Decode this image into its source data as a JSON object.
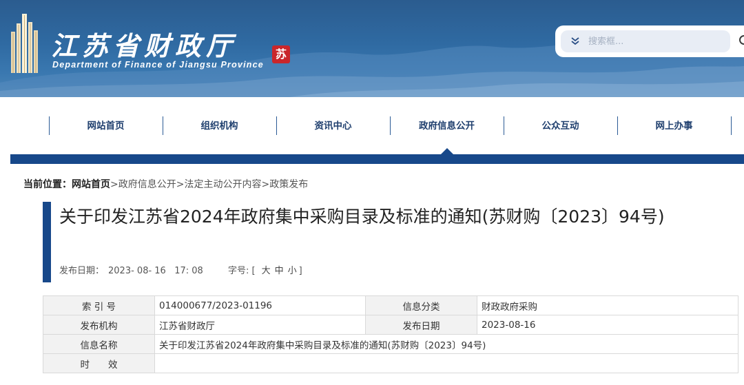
{
  "header": {
    "title": "江苏省财政厅",
    "subtitle": "Department of Finance of Jiangsu Province",
    "seal_text": "苏",
    "search_placeholder": "搜索框..."
  },
  "nav": {
    "items": [
      {
        "label": "网站首页"
      },
      {
        "label": "组织机构"
      },
      {
        "label": "资讯中心"
      },
      {
        "label": "政府信息公开"
      },
      {
        "label": "公众互动"
      },
      {
        "label": "网上办事"
      }
    ],
    "active_index": 3
  },
  "breadcrumb": {
    "prefix": "当前位置：",
    "home": "网站首页",
    "trail": ">政府信息公开>法定主动公开内容>政策发布"
  },
  "article": {
    "title": "关于印发江苏省2024年政府集中采购目录及标准的通知(苏财购〔2023〕94号)",
    "date_label": "发布日期：",
    "date_value": "2023- 08- 16   17: 08",
    "fontsize_label": "字号: [",
    "fontsize_large": "大",
    "fontsize_medium": "中",
    "fontsize_small": "小",
    "fontsize_end": "]"
  },
  "info_table": {
    "rows": [
      {
        "k1": "索 引 号",
        "v1": "014000677/2023-01196",
        "k2": "信息分类",
        "v2": "财政政府采购"
      },
      {
        "k1": "发布机构",
        "v1": "江苏省财政厅",
        "k2": "发布日期",
        "v2": "2023-08-16"
      },
      {
        "k1": "信息名称",
        "v1": "关于印发江苏省2024年政府集中采购目录及标准的通知(苏财购〔2023〕94号)"
      },
      {
        "k1": "时　　效",
        "v1": ""
      }
    ]
  },
  "colors": {
    "banner": "#2f6aa2",
    "nav_bar": "#17488a",
    "nav_text": "#1f3f6e"
  }
}
